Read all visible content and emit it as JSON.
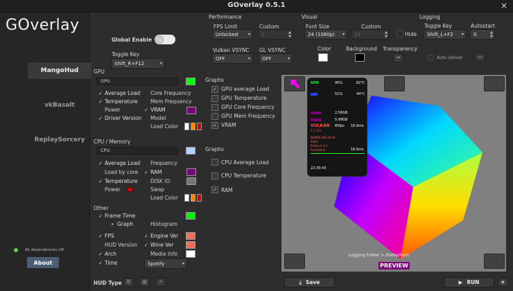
{
  "window": {
    "title": "GOverlay 0.5.1",
    "close_glyph": "×"
  },
  "sidebar": {
    "logo": "GOverlay",
    "items": [
      {
        "label": "MangoHud",
        "active": true
      },
      {
        "label": "vkBasalt",
        "active": false
      },
      {
        "label": "ReplaySorcery",
        "active": false
      }
    ],
    "status": "All dependencies OK",
    "about_label": "About"
  },
  "top": {
    "global_enable_label": "Global Enable",
    "toggle_key_label": "Toggle Key",
    "toggle_key_value": "Shift_R+F12",
    "performance": {
      "header": "Performance",
      "fps_limit_label": "FPS Limit",
      "fps_limit_value": "Unlocked",
      "custom_label": "Custom",
      "custom_value": "1",
      "vsync_label": "Vulkan VSYNC",
      "vsync_value": "OFF",
      "gl_vsync_label": "GL VSYNC",
      "gl_vsync_value": "OFF"
    },
    "visual": {
      "header": "Visual",
      "font_size_label": "Font Size",
      "font_size_value": "24 (1080p)",
      "custom_label": "Custom",
      "custom_value": "24",
      "hide_label": "Hide",
      "color_label": "Color",
      "background_label": "Background",
      "transparency_label": "Transparency"
    },
    "logging": {
      "header": "Logging",
      "toggle_key_label": "Toggle Key",
      "toggle_key_value": "Shift_L+F2",
      "autostart_label": "Autostart",
      "autostart_value": "0",
      "auto_upload_label": "Auto Upload"
    }
  },
  "gpu": {
    "header": "GPU",
    "entry_value": "GPU",
    "swatch_color": "#00ff00",
    "checks": [
      {
        "label": "Average Load",
        "checked": true
      },
      {
        "label": "Core Frequency",
        "checked": false
      },
      {
        "label": "Temperature",
        "checked": true
      },
      {
        "label": "Mem Frequency",
        "checked": false
      },
      {
        "label": "Power",
        "checked": false
      },
      {
        "label": "VRAM",
        "checked": true
      },
      {
        "label": "Driver Version",
        "checked": true
      },
      {
        "label": "Model",
        "checked": false
      },
      {
        "label": "Load Color",
        "checked": false
      }
    ],
    "vram_color": "#7a007a",
    "graphs_header": "Graphs",
    "graphs": [
      {
        "label": "GPU average Load",
        "checked": true
      },
      {
        "label": "GPU Temperature",
        "checked": false
      },
      {
        "label": "GPU Core Frequency",
        "checked": false
      },
      {
        "label": "GPU Mem Frequency",
        "checked": false
      },
      {
        "label": "VRAM",
        "checked": true
      }
    ]
  },
  "cpu": {
    "header": "CPU / Memory",
    "entry_value": "CPU",
    "swatch_color": "#b0d0ff",
    "checks": [
      {
        "label": "Average Load",
        "checked": true
      },
      {
        "label": "Frequency",
        "checked": false
      },
      {
        "label": "Load by core",
        "checked": false
      },
      {
        "label": "RAM",
        "checked": true
      },
      {
        "label": "Temperature",
        "checked": true
      },
      {
        "label": "DISK IO",
        "checked": false
      },
      {
        "label": "Power",
        "checked": false
      },
      {
        "label": "Swap",
        "checked": false
      },
      {
        "label": "Load Color",
        "checked": false
      }
    ],
    "ram_color": "#7a007a",
    "disk_color": "#777777",
    "graphs_header": "Graphs",
    "graphs": [
      {
        "label": "CPU Average Load",
        "checked": false
      },
      {
        "label": "CPU Temperature",
        "checked": false
      },
      {
        "label": "RAM",
        "checked": true
      }
    ]
  },
  "other": {
    "header": "Other",
    "frame_time_label": "Frame Time",
    "frame_time_color": "#00ee00",
    "graph_label": "Graph",
    "histogram_label": "Histogram",
    "checks": [
      {
        "label": "FPS",
        "checked": true
      },
      {
        "label": "Engine Ver",
        "checked": true
      },
      {
        "label": "HUD Version",
        "checked": false
      },
      {
        "label": "Wine Ver",
        "checked": true
      },
      {
        "label": "Arch",
        "checked": true
      },
      {
        "label": "Media Info",
        "checked": false
      },
      {
        "label": "Time",
        "checked": true
      }
    ],
    "engine_color": "#f07060",
    "wine_color": "#f07060",
    "media_color": "#ffffff",
    "media_player": "Spotify"
  },
  "preview": {
    "hud": {
      "gpu": "GPU",
      "gpu_load": "95%",
      "gpu_temp": "82°C",
      "cpu_load": "51%",
      "cpu_temp": "44°C",
      "vram": "2.56GB",
      "ram": "5.99GB",
      "engine": "VULKAN",
      "fps": "60fps",
      "frametime": "16.6ms",
      "engine_ver": "1.2.131",
      "driver": "NVIDIA 440.10.00",
      "arch": "64bit",
      "wine": "Proton 5.0-4",
      "frametime_label": "Frametime",
      "frametime_val": "16.6ms",
      "time": "22:30:43"
    },
    "logging_folder": "Logging Folder > /home/liam",
    "label": "PREVIEW"
  },
  "bottom": {
    "hud_type_label": "HUD Type",
    "save_label": "Save",
    "run_label": "RUN"
  }
}
